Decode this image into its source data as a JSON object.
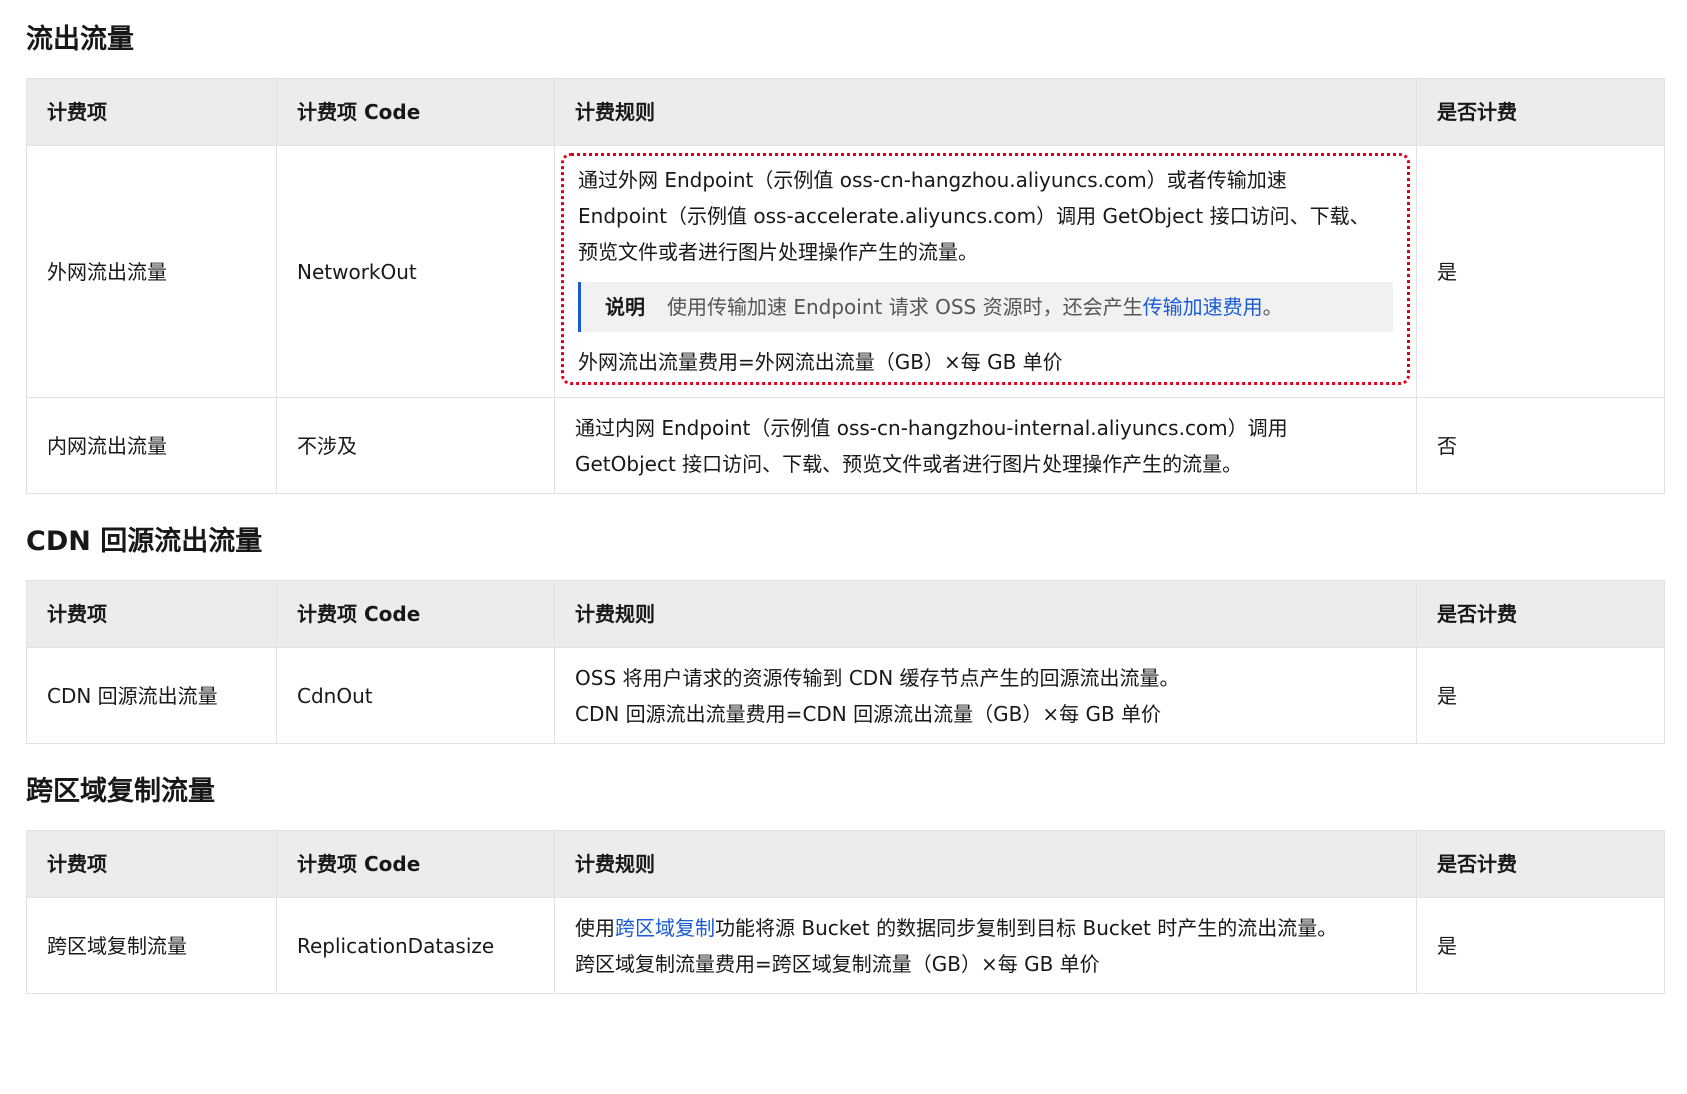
{
  "sections": [
    {
      "title": "流出流量",
      "headers": [
        "计费项",
        "计费项 Code",
        "计费规则",
        "是否计费"
      ],
      "rows": [
        {
          "item": "外网流出流量",
          "code": "NetworkOut",
          "rule_lines": [
            "通过外网 Endpoint（示例值 oss-cn-hangzhou.aliyuncs.com）或者传输加速",
            "Endpoint（示例值 oss-accelerate.aliyuncs.com）调用 GetObject 接口访问、下载、",
            "预览文件或者进行图片处理操作产生的流量。"
          ],
          "note": {
            "label": "说明",
            "text": "使用传输加速 Endpoint 请求 OSS 资源时，还会产生",
            "link": "传输加速费用",
            "suffix": "。"
          },
          "formula": "外网流出流量费用=外网流出流量（GB）×每 GB 单价",
          "charged": "是"
        },
        {
          "item": "内网流出流量",
          "code": "不涉及",
          "rule_lines": [
            "通过内网 Endpoint（示例值 oss-cn-hangzhou-internal.aliyuncs.com）调用",
            "GetObject 接口访问、下载、预览文件或者进行图片处理操作产生的流量。"
          ],
          "charged": "否"
        }
      ]
    },
    {
      "title": "CDN 回源流出流量",
      "headers": [
        "计费项",
        "计费项 Code",
        "计费规则",
        "是否计费"
      ],
      "rows": [
        {
          "item": "CDN 回源流出流量",
          "code": "CdnOut",
          "rule_lines": [
            "OSS 将用户请求的资源传输到 CDN 缓存节点产生的回源流出流量。",
            "CDN 回源流出流量费用=CDN 回源流出流量（GB）×每 GB 单价"
          ],
          "charged": "是"
        }
      ]
    },
    {
      "title": "跨区域复制流量",
      "headers": [
        "计费项",
        "计费项 Code",
        "计费规则",
        "是否计费"
      ],
      "rows": [
        {
          "item": "跨区域复制流量",
          "code": "ReplicationDatasize",
          "rule_prefix": "使用",
          "rule_link": "跨区域复制",
          "rule_suffix": "功能将源 Bucket 的数据同步复制到目标 Bucket 时产生的流出流量。",
          "formula": "跨区域复制流量费用=跨区域复制流量（GB）×每 GB 单价",
          "charged": "是"
        }
      ]
    }
  ],
  "colors": {
    "header_bg": "#ececec",
    "border": "#e2e2e2",
    "link": "#1a5cd7",
    "highlight": "#e0001b",
    "note_bg": "#f1f1f1"
  }
}
